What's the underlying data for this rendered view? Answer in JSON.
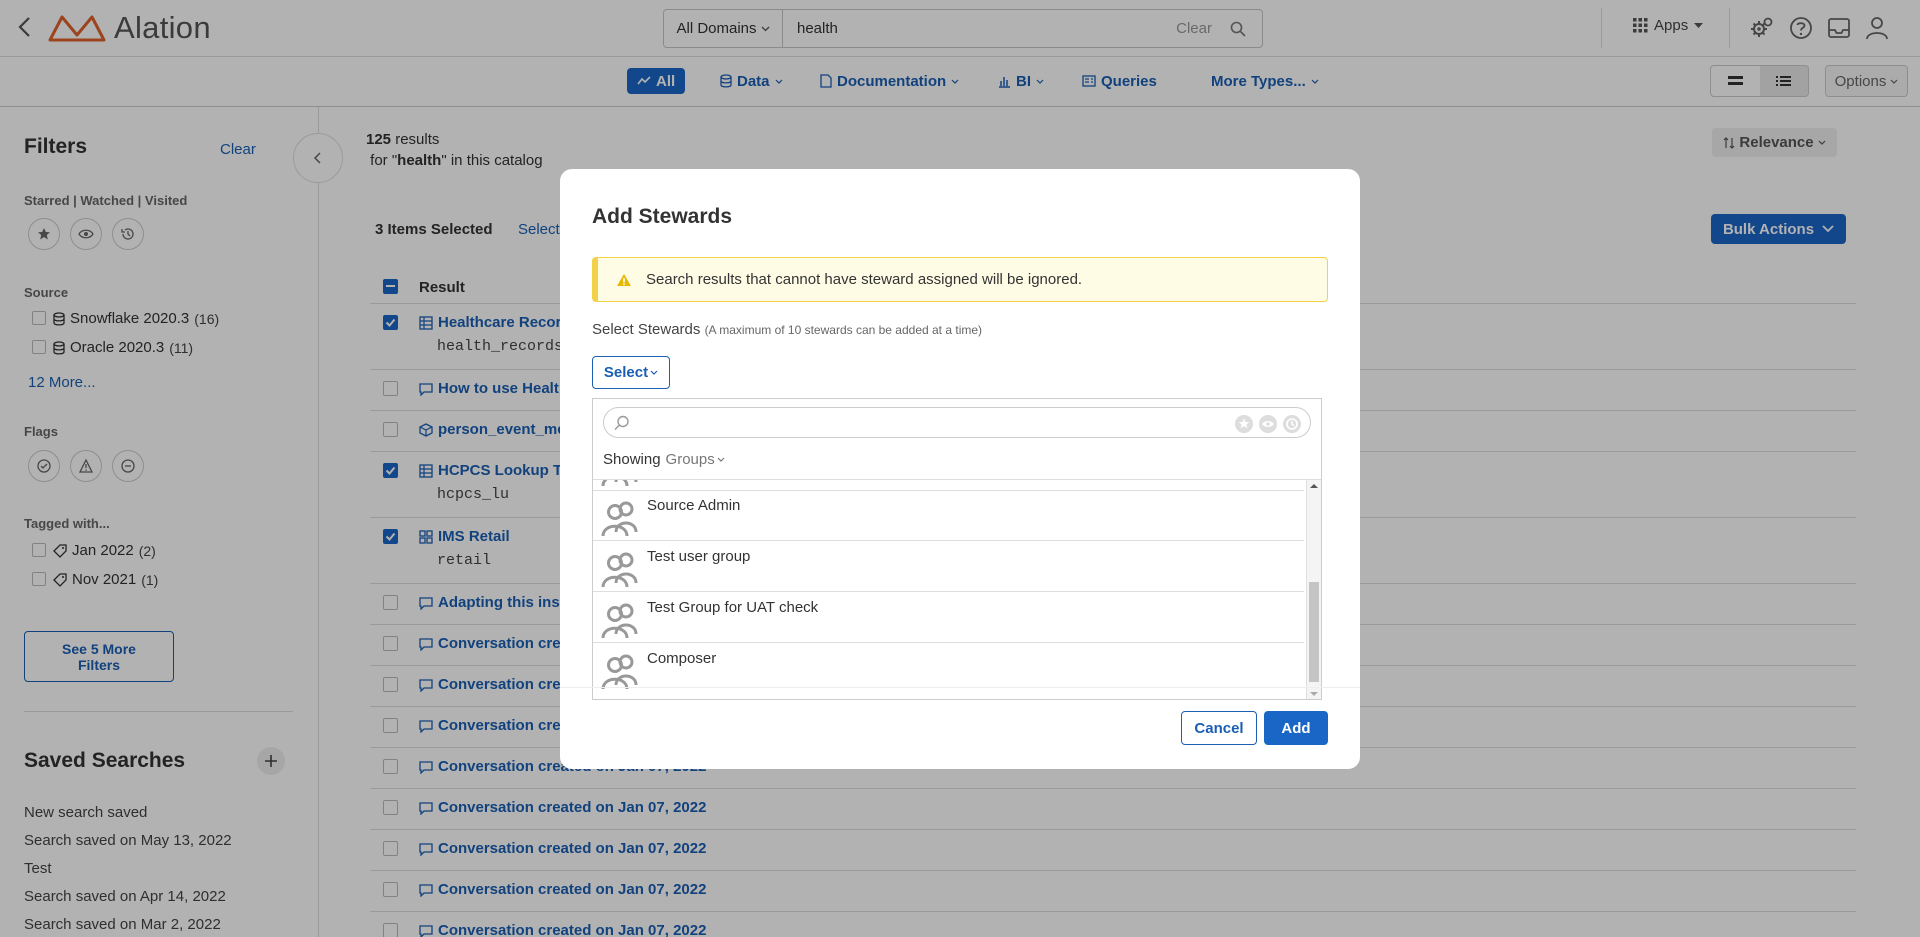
{
  "header": {
    "logo_text": "Alation",
    "domain_select": "All Domains",
    "search_query": "health",
    "search_clear": "Clear",
    "apps_label": "Apps"
  },
  "type_tabs": [
    {
      "label": "All",
      "icon": "trend-icon"
    },
    {
      "label": "Data",
      "icon": "database-icon"
    },
    {
      "label": "Documentation",
      "icon": "document-icon"
    },
    {
      "label": "BI",
      "icon": "bar-chart-icon"
    },
    {
      "label": "Queries",
      "icon": "query-icon"
    },
    {
      "label": "More Types...",
      "icon": ""
    }
  ],
  "options_label": "Options",
  "sidebar": {
    "title": "Filters",
    "clear": "Clear",
    "starred_label": "Starred | Watched | Visited",
    "source_label": "Source",
    "sources": [
      {
        "name": "Snowflake 2020.3",
        "count": "(16)"
      },
      {
        "name": "Oracle 2020.3",
        "count": "(11)"
      }
    ],
    "more_sources": "12 More...",
    "flags_label": "Flags",
    "tagged_label": "Tagged with...",
    "tags": [
      {
        "name": "Jan 2022",
        "count": "(2)"
      },
      {
        "name": "Nov 2021",
        "count": "(1)"
      }
    ],
    "see_more_line1": "See 5 More",
    "see_more_line2": "Filters",
    "saved_title": "Saved Searches",
    "saved_items": [
      "New search saved",
      "Search saved on May 13, 2022",
      "Test",
      "Search saved on Apr 14, 2022",
      "Search saved on Mar 2, 2022"
    ]
  },
  "main": {
    "results_count": "125",
    "results_word": "results",
    "for_prefix": "for \"",
    "for_query": "health",
    "for_suffix": "\" in this catalog",
    "relevance": "Relevance",
    "selected": "3 Items Selected",
    "select_link": "Select",
    "bulk_actions": "Bulk Actions",
    "column_header": "Result",
    "rows": [
      {
        "title": "Healthcare Recor",
        "sub": "health_records",
        "checked": true,
        "icon": "table-icon"
      },
      {
        "title": "How to use Healt",
        "sub": "",
        "checked": false,
        "icon": "conversation-icon"
      },
      {
        "title": "person_event_met",
        "sub": "",
        "checked": false,
        "icon": "cube-icon"
      },
      {
        "title": "HCPCS Lookup Ta",
        "sub": "hcpcs_lu",
        "checked": true,
        "icon": "table-icon"
      },
      {
        "title": "IMS Retail",
        "sub": "retail",
        "checked": true,
        "icon": "schema-icon"
      },
      {
        "title": "Adapting this insi",
        "sub": "",
        "checked": false,
        "icon": "conversation-icon"
      },
      {
        "title": "Conversation crea",
        "sub": "",
        "checked": false,
        "icon": "conversation-icon"
      },
      {
        "title": "Conversation crea",
        "sub": "",
        "checked": false,
        "icon": "conversation-icon"
      },
      {
        "title": "Conversation crea",
        "sub": "",
        "checked": false,
        "icon": "conversation-icon"
      },
      {
        "title": "Conversation created on Jan 07, 2022",
        "sub": "",
        "checked": false,
        "icon": "conversation-icon"
      },
      {
        "title": "Conversation created on Jan 07, 2022",
        "sub": "",
        "checked": false,
        "icon": "conversation-icon"
      },
      {
        "title": "Conversation created on Jan 07, 2022",
        "sub": "",
        "checked": false,
        "icon": "conversation-icon"
      },
      {
        "title": "Conversation created on Jan 07, 2022",
        "sub": "",
        "checked": false,
        "icon": "conversation-icon"
      },
      {
        "title": "Conversation created on Jan 07, 2022",
        "sub": "",
        "checked": false,
        "icon": "conversation-icon"
      }
    ]
  },
  "modal": {
    "title": "Add Stewards",
    "warning": "Search results that cannot have steward assigned will be ignored.",
    "select_label": "Select Stewards",
    "select_hint": "(A maximum of 10 stewards can be added at a time)",
    "select_button": "Select",
    "showing_label": "Showing",
    "showing_value": "Groups",
    "groups": [
      "Source Admin",
      "Test user group",
      "Test Group for UAT check",
      "Composer"
    ],
    "cancel": "Cancel",
    "add": "Add"
  },
  "colors": {
    "accent": "#1a66c7",
    "link": "#1a5fb4",
    "warning_border": "#f1d24a",
    "logo": "#e0622a"
  }
}
